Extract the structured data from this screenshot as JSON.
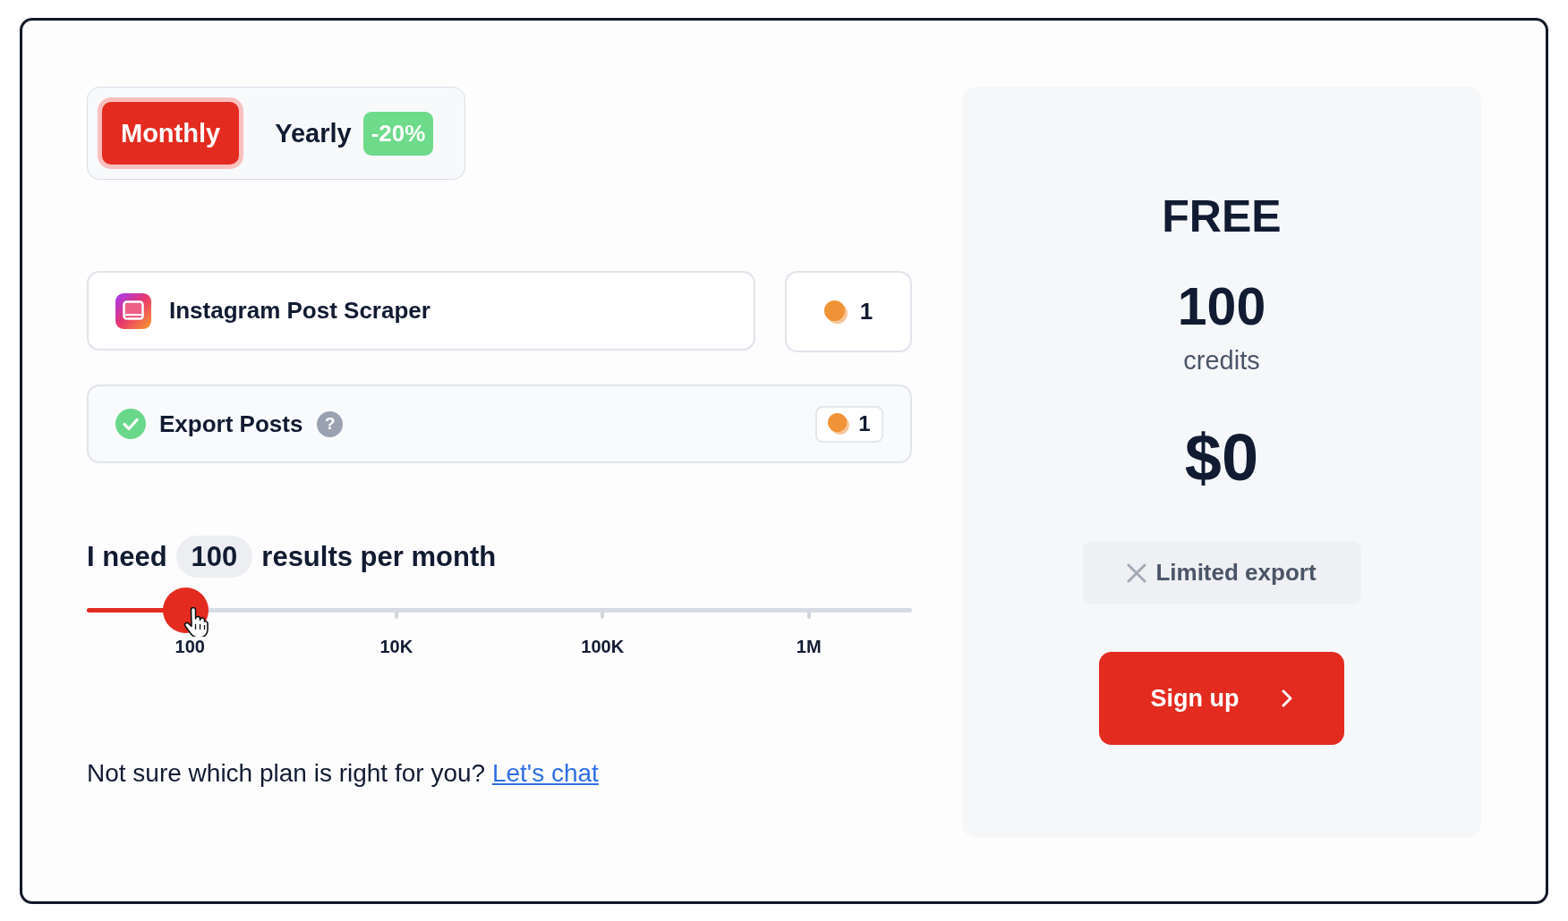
{
  "billing_toggle": [
    {
      "label": "Monthly",
      "selected": true
    },
    {
      "label": "Yearly",
      "selected": false,
      "badge": "-20%"
    }
  ],
  "actor": {
    "name": "Instagram Post Scraper",
    "credits": "1"
  },
  "add_ons": [
    {
      "label": "Export Posts",
      "checked": true,
      "help": "?",
      "credits": "1"
    }
  ],
  "results_slider": {
    "prefix": "I need",
    "value": "100",
    "suffix": "results per month",
    "level": 0.12,
    "ticks": [
      "100",
      "10K",
      "100K",
      "1M"
    ]
  },
  "footer": {
    "text": "Not sure which plan is right for you?",
    "link": "Let's chat"
  },
  "plan": {
    "name": "FREE",
    "credits": "100",
    "credits_label": "credits",
    "price": "$0",
    "features": [
      {
        "label": "Limited export",
        "included": false
      }
    ],
    "cta": "Sign up"
  }
}
